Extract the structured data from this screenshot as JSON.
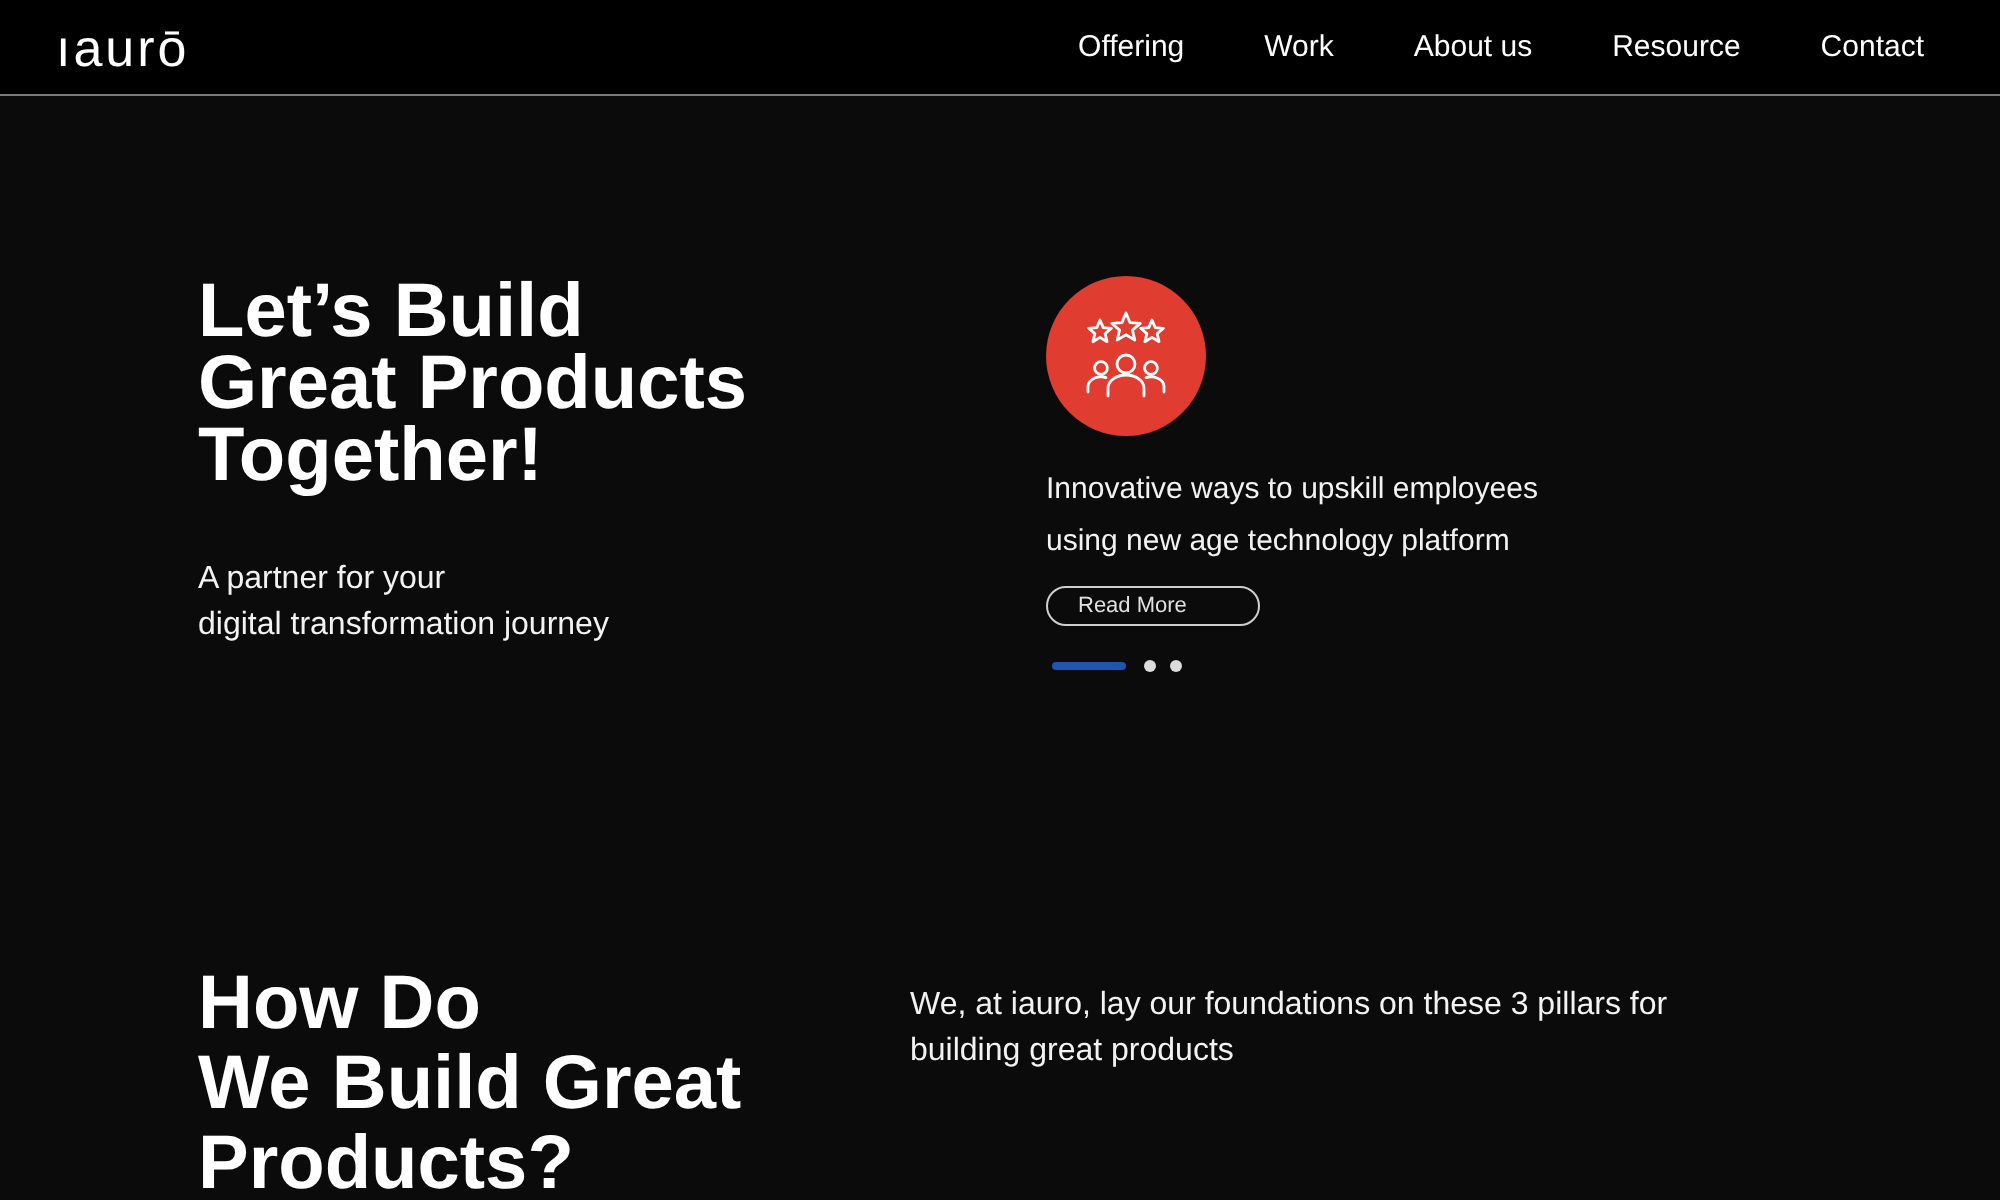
{
  "nav": {
    "logo": "ıaurō",
    "items": [
      {
        "label": "Offering"
      },
      {
        "label": "Work"
      },
      {
        "label": "About us"
      },
      {
        "label": "Resource"
      },
      {
        "label": "Contact"
      }
    ]
  },
  "hero": {
    "title_lines": [
      "Let’s Build",
      "Great Products",
      "Together!"
    ],
    "subtitle_lines": [
      "A partner for your",
      "digital transformation journey"
    ]
  },
  "carousel": {
    "text_lines": [
      "Innovative ways to upskill employees",
      "using new age technology platform"
    ],
    "button": "Read More",
    "slides": [
      {
        "selected": true
      },
      {
        "selected": false
      },
      {
        "selected": false
      }
    ]
  },
  "pillars": {
    "heading_lines": [
      "How Do",
      "We Build Great",
      "Products?"
    ],
    "intro_lines": [
      "We, at iauro, lay our foundations on these 3 pillars for",
      "building great products"
    ]
  }
}
